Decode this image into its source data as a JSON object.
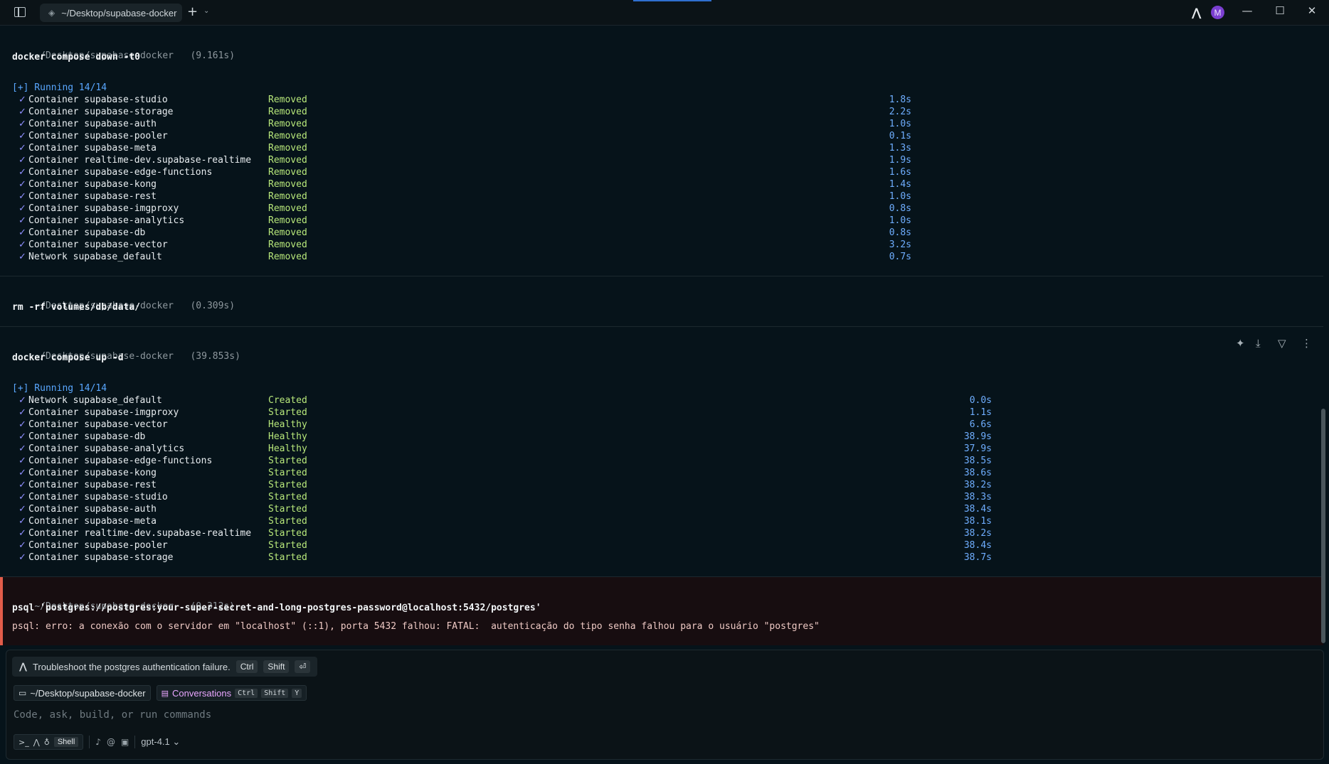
{
  "titlebar": {
    "tab_label": "~/Desktop/supabase-docker",
    "plus": "+",
    "caret": "⌄",
    "avatar_letter": "M",
    "win_min": "—",
    "win_max": "☐",
    "win_close": "✕"
  },
  "blocks": [
    {
      "prompt": "~/Desktop/supabase-docker",
      "duration": "(9.161s)",
      "command": "docker compose down -t0",
      "running": "[+] Running 14/14",
      "rows": [
        {
          "name": "Container supabase-studio",
          "status": "Removed",
          "time": "1.8s"
        },
        {
          "name": "Container supabase-storage",
          "status": "Removed",
          "time": "2.2s"
        },
        {
          "name": "Container supabase-auth",
          "status": "Removed",
          "time": "1.0s"
        },
        {
          "name": "Container supabase-pooler",
          "status": "Removed",
          "time": "0.1s"
        },
        {
          "name": "Container supabase-meta",
          "status": "Removed",
          "time": "1.3s"
        },
        {
          "name": "Container realtime-dev.supabase-realtime",
          "status": "Removed",
          "time": "1.9s"
        },
        {
          "name": "Container supabase-edge-functions",
          "status": "Removed",
          "time": "1.6s"
        },
        {
          "name": "Container supabase-kong",
          "status": "Removed",
          "time": "1.4s"
        },
        {
          "name": "Container supabase-rest",
          "status": "Removed",
          "time": "1.0s"
        },
        {
          "name": "Container supabase-imgproxy",
          "status": "Removed",
          "time": "0.8s"
        },
        {
          "name": "Container supabase-analytics",
          "status": "Removed",
          "time": "1.0s"
        },
        {
          "name": "Container supabase-db",
          "status": "Removed",
          "time": "0.8s"
        },
        {
          "name": "Container supabase-vector",
          "status": "Removed",
          "time": "3.2s"
        },
        {
          "name": "Network supabase_default",
          "status": "Removed",
          "time": "0.7s"
        }
      ]
    },
    {
      "prompt": "~/Desktop/supabase-docker",
      "duration": "(0.309s)",
      "command": "rm -rf volumes/db/data/"
    },
    {
      "prompt": "~/Desktop/supabase-docker",
      "duration": "(39.853s)",
      "command": "docker compose up -d",
      "running": "[+] Running 14/14",
      "rows": [
        {
          "name": "Network supabase_default",
          "status": "Created",
          "time": "0.0s"
        },
        {
          "name": "Container supabase-imgproxy",
          "status": "Started",
          "time": "1.1s"
        },
        {
          "name": "Container supabase-vector",
          "status": "Healthy",
          "time": "6.6s"
        },
        {
          "name": "Container supabase-db",
          "status": "Healthy",
          "time": "38.9s"
        },
        {
          "name": "Container supabase-analytics",
          "status": "Healthy",
          "time": "37.9s"
        },
        {
          "name": "Container supabase-edge-functions",
          "status": "Started",
          "time": "38.5s"
        },
        {
          "name": "Container supabase-kong",
          "status": "Started",
          "time": "38.6s"
        },
        {
          "name": "Container supabase-rest",
          "status": "Started",
          "time": "38.2s"
        },
        {
          "name": "Container supabase-studio",
          "status": "Started",
          "time": "38.3s"
        },
        {
          "name": "Container supabase-auth",
          "status": "Started",
          "time": "38.4s"
        },
        {
          "name": "Container supabase-meta",
          "status": "Started",
          "time": "38.1s"
        },
        {
          "name": "Container realtime-dev.supabase-realtime",
          "status": "Started",
          "time": "38.2s"
        },
        {
          "name": "Container supabase-pooler",
          "status": "Started",
          "time": "38.4s"
        },
        {
          "name": "Container supabase-storage",
          "status": "Started",
          "time": "38.7s"
        }
      ]
    },
    {
      "prompt": "~/Desktop/supabase-docker",
      "duration": "(0.312s)",
      "command": "psql 'postgres://postgres:your-super-secret-and-long-postgres-password@localhost:5432/postgres'",
      "error": "psql: erro: a conexão com o servidor em \"localhost\" (::1), porta 5432 falhou: FATAL:  autenticação do tipo senha falhou para o usuário \"postgres\""
    }
  ],
  "check_glyph": "✓",
  "input": {
    "suggestion": "Troubleshoot the postgres authentication failure.",
    "suggestion_keys": [
      "Ctrl",
      "Shift",
      "⏎"
    ],
    "dir_chip": "~/Desktop/supabase-docker",
    "conversations_label": "Conversations",
    "conversations_keys": [
      "Ctrl",
      "Shift",
      "Y"
    ],
    "placeholder": "Code, ask, build, or run commands",
    "mode_shell": "Shell",
    "model": "gpt-4.1"
  },
  "colors": {
    "status_green": "#b7e77a",
    "time_blue": "#6faeff",
    "error_border": "#e25c4a",
    "avatar": "#7b3fd1"
  }
}
